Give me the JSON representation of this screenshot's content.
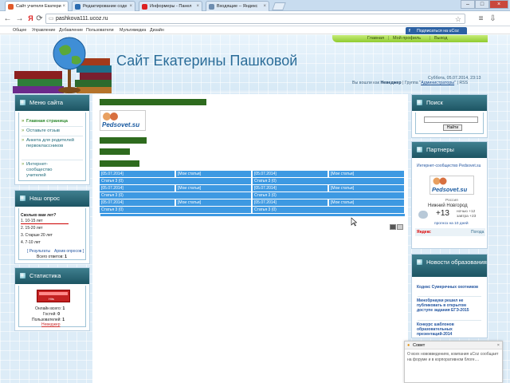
{
  "browser": {
    "tabs": [
      {
        "title": "Сайт учителя Екатери"
      },
      {
        "title": "Редактирование соде"
      },
      {
        "title": "Информеры - Панел"
      },
      {
        "title": "Входящие -- Яндекс"
      }
    ],
    "url": "pashkova111.ucoz.ru",
    "bookmarks": [
      "Общее",
      "Управление",
      "Добавление",
      "Пользователи",
      "Мультимедиа",
      "Дизайн"
    ],
    "ucoz_button": "Подписаться на uCoz"
  },
  "site": {
    "top_nav": [
      "Главная",
      "Мой профиль",
      "Выход"
    ],
    "title": "Сайт Екатерины Пашковой",
    "date_line": "Суббота, 05.07.2014, 23:13",
    "login_prefix": "Вы вошли как",
    "login_user": "Неведжер",
    "group_prefix": "| Группа \"",
    "group_name": "Администраторы",
    "group_suffix": "\" | RSS"
  },
  "left": {
    "menu": {
      "title": "Меню сайта",
      "items": [
        "Главная страница",
        "Оставьте отзыв",
        "Анкета для родителей первоклассников",
        "Интернет-сообщество учителей"
      ]
    },
    "poll": {
      "title": "Наш опрос",
      "question": "Сколько вам лет?",
      "options": [
        "1. 10-15 лет",
        "2. 15-20 лет",
        "3. Старше 20 лет",
        "4. 7-10 лет"
      ],
      "results_link": "[ Результаты",
      "archive_link": "Архив опросов ]",
      "total_label": "Всего ответов:",
      "total_value": "1"
    },
    "stats": {
      "title": "Статистика",
      "counter_text": "Hits",
      "online_label": "Онлайн всего:",
      "online_value": "1",
      "guests_label": "Гостей:",
      "guests_value": "0",
      "users_label": "Пользователей:",
      "users_value": "1",
      "user_name": "Неведжер"
    }
  },
  "content": {
    "pedsovet_logo": "Pedsovet.su",
    "rows": [
      {
        "a": "[05.07.2014]",
        "b": "[Мои статьи]",
        "c": "[05.07.2014]",
        "d": "[Мои статьи]"
      },
      {
        "a": "Статья 3 (0)",
        "c": "Статья 3 (0)"
      },
      {
        "a": "[05.07.2014]",
        "b": "[Мои статьи]",
        "c": "[05.07.2014]",
        "d": "[Мои статьи]"
      },
      {
        "a": "Статья 3 (0)",
        "c": "Статья 3 (0)"
      },
      {
        "a": "[05.07.2014]",
        "b": "[Мои статьи]",
        "c": "[05.07.2014]",
        "d": "[Мои статьи]"
      },
      {
        "a": "Статья 3 (0)",
        "c": "Статья 3 (0)"
      }
    ]
  },
  "right": {
    "search": {
      "title": "Поиск",
      "button": "Найти",
      "value": ""
    },
    "partners": {
      "title": "Партнеры",
      "link_label": "Интернет-сообщество Pedsovet.su",
      "logo": "Pedsovet.su"
    },
    "weather": {
      "country": "Россия",
      "city": "Нижний Новгород",
      "temp": "+13",
      "night_label": "ночью +12",
      "tomorrow_label": "завтра +23",
      "forecast_link": "прогноз на 10 дней",
      "brand": "Яндекс",
      "brand_suffix": "Погода"
    },
    "news": {
      "title": "Новости образования",
      "items": [
        "Кодекс Сумеречных охотников",
        "Минобрнауки решил не публиковать в открытом доступе задания ЕГЭ-2015",
        "Конкурс шаблонов образовательных презентаций-2014"
      ]
    }
  },
  "notification": {
    "title": "Совет",
    "text": "О всех нововведениях, компания uCoz сообщает на форуме и в корпоративном блоге...."
  },
  "colors": {
    "accent": "#1d5563",
    "green": "#8fcb2d",
    "blue": "#3d99e2",
    "title": "#2a6c98"
  }
}
